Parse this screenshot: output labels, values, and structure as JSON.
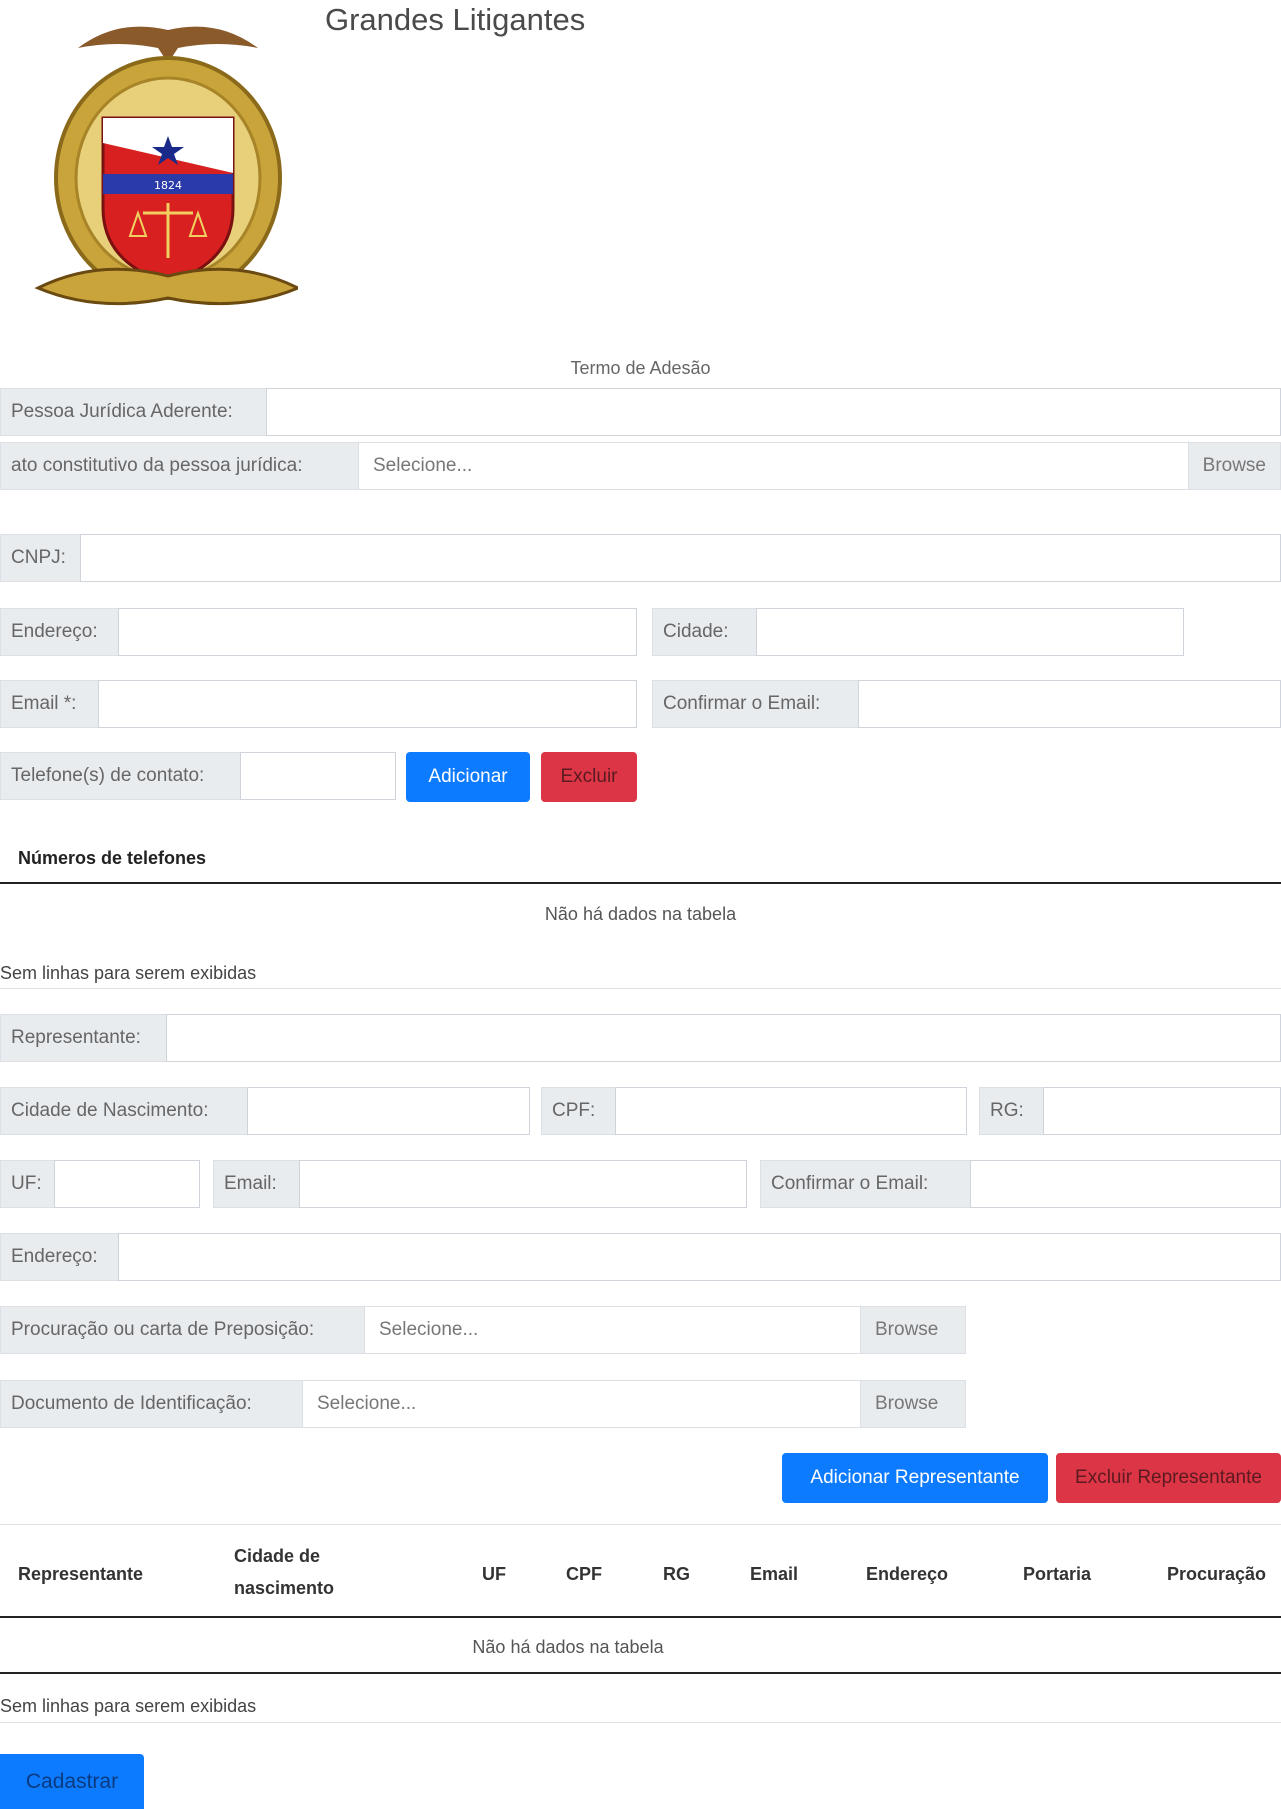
{
  "page": {
    "title": "Grandes Litigantes"
  },
  "logo": {
    "icon": "coat-of-arms-emblem",
    "caption": "1824"
  },
  "form": {
    "section_title": "Termo de Adesão",
    "pessoa_juridica_label": "Pessoa Jurídica Aderente:",
    "ato_constitutivo_label": "ato constitutivo da pessoa jurídica:",
    "file_placeholder": "Selecione...",
    "browse_label": "Browse",
    "cnpj_label": "CNPJ:",
    "endereco_label": "Endereço:",
    "cidade_label": "Cidade:",
    "email_label": "Email *:",
    "confirmar_email_label": "Confirmar o Email:",
    "telefone_label": "Telefone(s) de contato:",
    "adicionar_label": "Adicionar",
    "excluir_label": "Excluir"
  },
  "phones_table": {
    "caption": "Números de telefones",
    "empty_message": "Não há dados na tabela",
    "info": "Sem linhas para serem exibidas"
  },
  "representante": {
    "representante_label": "Representante:",
    "cidade_nascimento_label": "Cidade de Nascimento:",
    "cpf_label": "CPF:",
    "rg_label": "RG:",
    "uf_label": "UF:",
    "email_label": "Email:",
    "confirmar_email_label": "Confirmar o Email:",
    "endereco_label": "Endereço:",
    "procuracao_label": "Procuração ou carta de Preposição:",
    "documento_label": "Documento de Identificação:",
    "file_placeholder": "Selecione...",
    "browse_label": "Browse",
    "adicionar_label": "Adicionar Representante",
    "excluir_label": "Excluir Representante"
  },
  "rep_table": {
    "columns": [
      "Representante",
      "Cidade de nascimento",
      "UF",
      "CPF",
      "RG",
      "Email",
      "Endereço",
      "Portaria",
      "Procuração"
    ],
    "empty_message": "Não há dados na tabela",
    "info": "Sem linhas para serem exibidas"
  },
  "submit": {
    "label": "Cadastrar"
  },
  "colors": {
    "primary": "#0d7bff",
    "danger": "#dc3545"
  }
}
